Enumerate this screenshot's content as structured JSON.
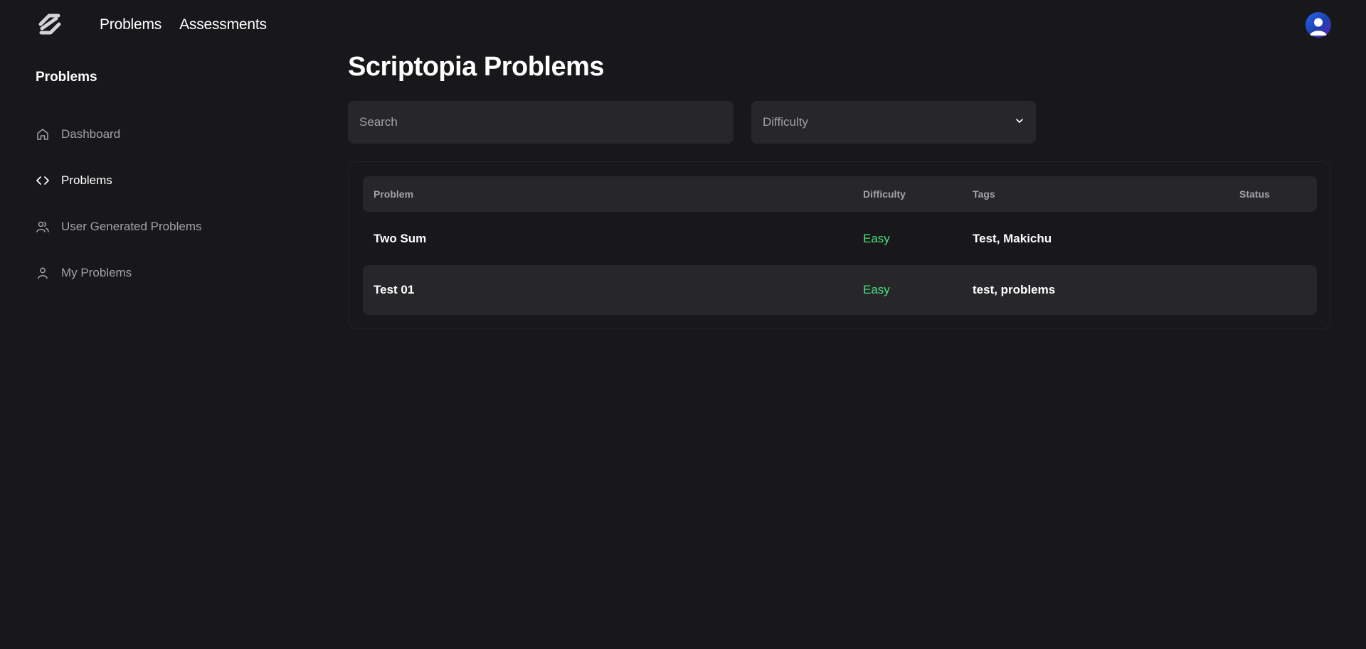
{
  "topnav": {
    "links": [
      "Problems",
      "Assessments"
    ]
  },
  "sidebar": {
    "title": "Problems",
    "items": [
      {
        "label": "Dashboard",
        "icon": "home-icon"
      },
      {
        "label": "Problems",
        "icon": "code-icon",
        "active": true
      },
      {
        "label": "User Generated Problems",
        "icon": "users-icon"
      },
      {
        "label": "My Problems",
        "icon": "user-icon"
      }
    ]
  },
  "main": {
    "title": "Scriptopia Problems",
    "search": {
      "placeholder": "Search"
    },
    "difficulty_filter": {
      "label": "Difficulty"
    }
  },
  "table": {
    "headers": [
      "Problem",
      "Difficulty",
      "Tags",
      "Status"
    ],
    "rows": [
      {
        "problem": "Two Sum",
        "difficulty": "Easy",
        "tags": "Test, Makichu",
        "status": ""
      },
      {
        "problem": "Test 01",
        "difficulty": "Easy",
        "tags": "test, problems",
        "status": ""
      }
    ]
  },
  "colors": {
    "background": "#18181b",
    "surface": "#27272a",
    "easy": "#4ade80",
    "avatar_accent": "#2563eb"
  }
}
